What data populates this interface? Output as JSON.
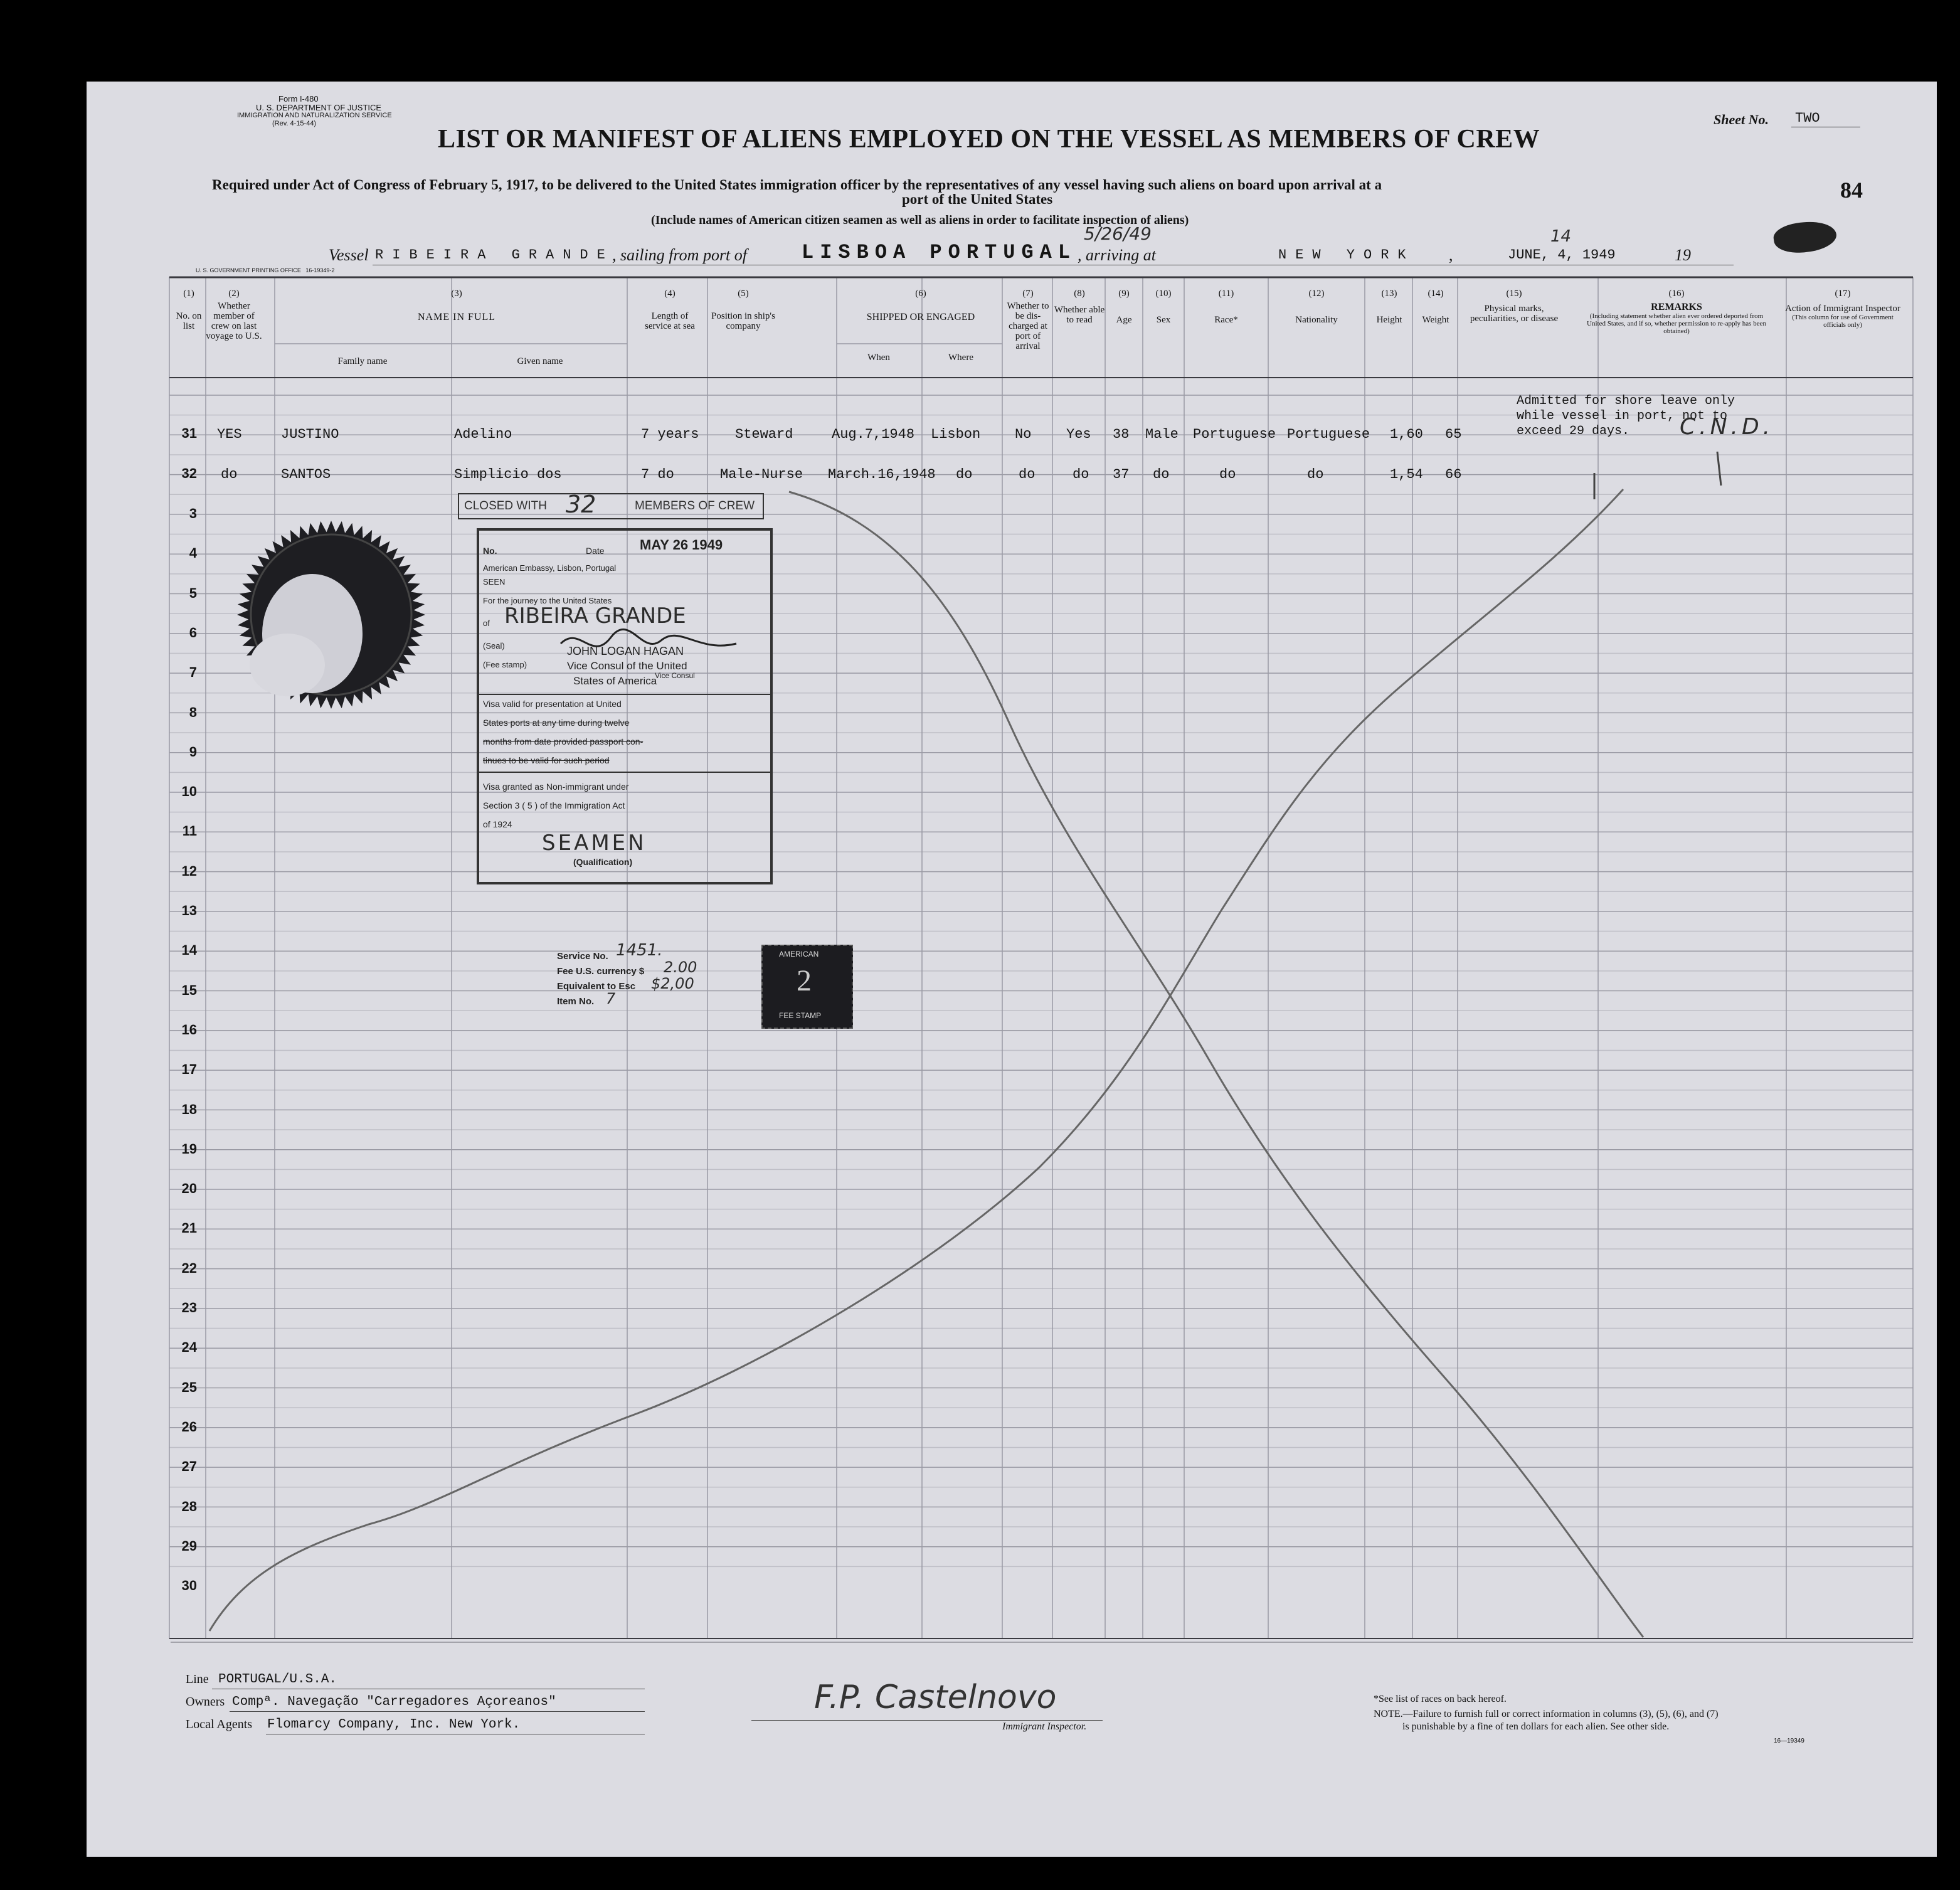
{
  "form": {
    "form_no": "Form I-480",
    "department": "U. S. DEPARTMENT OF JUSTICE",
    "service": "IMMIGRATION AND NATURALIZATION SERVICE",
    "revision": "(Rev. 4-15-44)",
    "printing_office": "U. S. GOVERNMENT PRINTING OFFICE",
    "print_code": "16-19349-2",
    "sheet_label": "Sheet No.",
    "sheet_value": "TWO",
    "page_number": "84",
    "title": "LIST OR MANIFEST OF ALIENS EMPLOYED ON THE VESSEL AS MEMBERS OF CREW",
    "subtitle_1": "Required under Act of Congress of February 5, 1917, to be delivered to the United States immigration officer by the representatives of any vessel having such aliens on board upon arrival at a",
    "subtitle_2": "port of the United States",
    "subtitle_3": "(Include names of American citizen seamen as well as aliens in order to facilitate inspection of aliens)"
  },
  "vessel_line": {
    "vessel_label": "Vessel",
    "vessel_name": "RIBEIRA GRANDE",
    "sailing_label": ", sailing from port of",
    "port": "LISBOA PORTUGAL",
    "date_note": "5/26/49",
    "arriving_label": ", arriving at",
    "arriving_port": "NEW YORK",
    "arrival_date": "JUNE, 4, 1949",
    "arrival_day_note": "14",
    "year_suffix": "19"
  },
  "columns": {
    "c1": {
      "num": "(1)",
      "label": "No. on list"
    },
    "c2": {
      "num": "(2)",
      "label": "Whether member of crew on last voyage to U.S."
    },
    "c3": {
      "num": "(3)",
      "label": "NAME IN FULL",
      "sub1": "Family name",
      "sub2": "Given name"
    },
    "c4": {
      "num": "(4)",
      "label": "Length of service at sea"
    },
    "c5": {
      "num": "(5)",
      "label": "Position in ship's company"
    },
    "c6": {
      "num": "(6)",
      "label": "SHIPPED OR ENGAGED",
      "sub1": "When",
      "sub2": "Where"
    },
    "c7": {
      "num": "(7)",
      "label": "Whether to be dis-charged at port of arrival"
    },
    "c8": {
      "num": "(8)",
      "label": "Whether able to read"
    },
    "c9": {
      "num": "(9)",
      "label": "Age"
    },
    "c10": {
      "num": "(10)",
      "label": "Sex"
    },
    "c11": {
      "num": "(11)",
      "label": "Race*"
    },
    "c12": {
      "num": "(12)",
      "label": "Nationality"
    },
    "c13": {
      "num": "(13)",
      "label": "Height"
    },
    "c14": {
      "num": "(14)",
      "label": "Weight"
    },
    "c15": {
      "num": "(15)",
      "label": "Physical marks, peculiarities, or disease"
    },
    "c16": {
      "num": "(16)",
      "label": "REMARKS",
      "sub": "(Including statement whether alien ever ordered deported from United States, and if so, whether permission to re-apply has been obtained)"
    },
    "c17": {
      "num": "(17)",
      "label": "Action of Immigrant Inspector",
      "sub": "(This column for use of Government officials only)"
    }
  },
  "rows": [
    {
      "no": "31",
      "member": "YES",
      "family": "JUSTINO",
      "given": "Adelino",
      "service": "7 years",
      "position": "Steward",
      "when": "Aug.7,1948",
      "where": "Lisbon",
      "discharged": "No",
      "read": "Yes",
      "age": "38",
      "sex": "Male",
      "race": "Portuguese",
      "nationality": "Portuguese",
      "height": "1,60",
      "weight": "65"
    },
    {
      "no": "32",
      "member": "do",
      "family": "SANTOS",
      "given": "Simplicio dos",
      "service": "7 do",
      "position": "Male-Nurse",
      "when": "March.16,1948",
      "where": "do",
      "discharged": "do",
      "read": "do",
      "age": "37",
      "sex": "do",
      "race": "do",
      "nationality": "do",
      "height": "1,54",
      "weight": "66"
    }
  ],
  "line_numbers": [
    "3",
    "4",
    "5",
    "6",
    "7",
    "8",
    "9",
    "10",
    "11",
    "12",
    "13",
    "14",
    "15",
    "16",
    "17",
    "18",
    "19",
    "20",
    "21",
    "22",
    "23",
    "24",
    "25",
    "26",
    "27",
    "28",
    "29",
    "30"
  ],
  "remarks_note": {
    "line1": "Admitted for shore leave only",
    "line2": "while vessel in port, not to",
    "line3": "exceed 29 days.",
    "initials": "C.N.D."
  },
  "closed_stamp": {
    "left": "CLOSED WITH",
    "count": "32",
    "right": "MEMBERS OF CREW"
  },
  "visa_stamp": {
    "no_label": "No.",
    "date_label": "Date",
    "date": "MAY 26 1949",
    "embassy": "American Embassy, Lisbon, Portugal",
    "seen": "SEEN",
    "journey": "For the journey to the United States",
    "of_label": "of",
    "vessel": "RIBEIRA GRANDE",
    "seal": "(Seal)",
    "consul_name": "JOHN LOGAN HAGAN",
    "fee_stamp": "(Fee stamp)",
    "consul_title_1": "Vice Consul of the United",
    "consul_title_2": "States of America",
    "consul_hand": "Vice Consul",
    "valid_1": "Visa valid for presentation at United",
    "valid_2": "States ports at any time during twelve",
    "valid_3": "months from date provided passport con-",
    "valid_4": "tinues to be valid for such period",
    "granted_1": "Visa granted as Non-immigrant under",
    "granted_2": "Section 3 ( 5 ) of the Immigration Act",
    "granted_3": "of 1924",
    "class": "SEAMEN",
    "class_sub": "(Qualification)"
  },
  "fee_block": {
    "service_label": "Service No.",
    "service_value": "1451.",
    "fee_label": "Fee U.S. currency $",
    "fee_value": "2.00",
    "equiv_label": "Equivalent to Esc",
    "equiv_value": "$2,00",
    "item_label": "Item No.",
    "item_value": "7"
  },
  "revenue_stamp": {
    "top": "AMERICAN",
    "value": "2",
    "bottom": "FEE STAMP"
  },
  "footer": {
    "line_label": "Line",
    "line_value": "PORTUGAL/U.S.A.",
    "owners_label": "Owners",
    "owners_value": "Compª. Navegação \"Carregadores Açoreanos\"",
    "agents_label": "Local Agents",
    "agents_value": "Flomarcy Company, Inc. New York.",
    "signature": "F.P. Castelnovo",
    "inspector_label": "Immigrant Inspector.",
    "note_races": "*See list of races on back hereof.",
    "note_label": "NOTE.",
    "note_text_1": "—Failure to furnish full or correct information in columns (3), (5), (6), and (7)",
    "note_text_2": "is punishable by a fine of ten dollars for each alien. See other side.",
    "code": "16—19349"
  },
  "colors": {
    "paper": "#dcdce2",
    "ink": "#151515",
    "grid": "#9a9aa4",
    "background": "#000000"
  }
}
